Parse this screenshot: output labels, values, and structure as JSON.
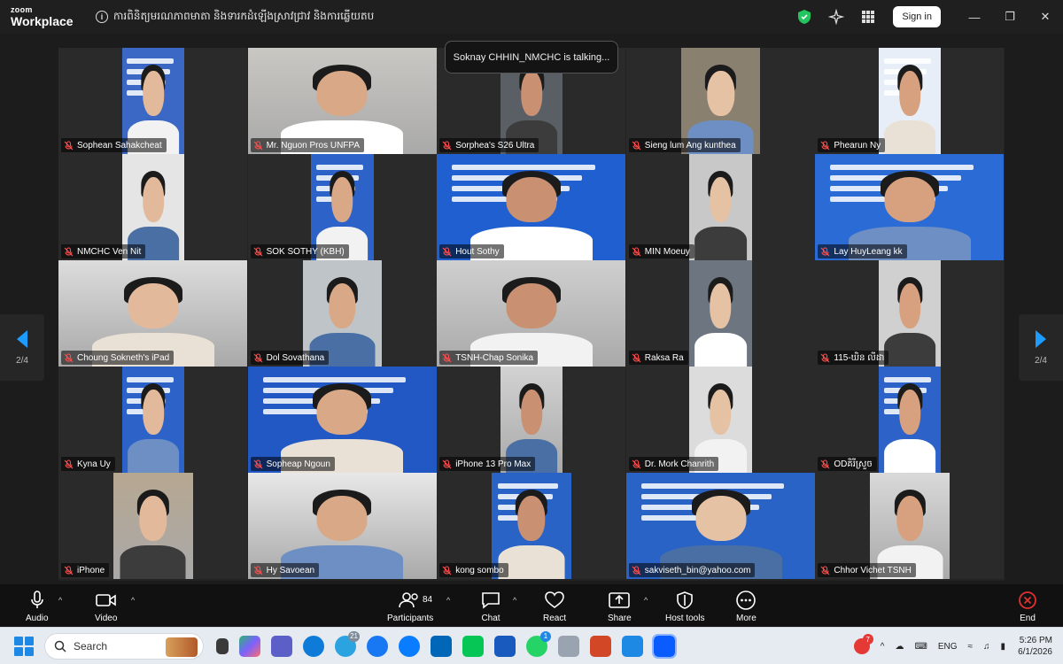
{
  "app": {
    "brand_top": "zoom",
    "brand_bottom": "Workplace",
    "meeting_title": "ការពិនិត្យមរណភាពមាតា និងទារកដំឡើងស្រាវជ្រាវ និងការឆ្លើយតប",
    "sign_in": "Sign in"
  },
  "stage": {
    "talking": "Soknay CHHIN_NMCHC is talking...",
    "page_left": "2/4",
    "page_right": "2/4"
  },
  "participants": [
    {
      "name": "Sophean Sahakcheat"
    },
    {
      "name": "Mr. Nguon Pros UNFPA"
    },
    {
      "name": "Sorphea's S26 Ultra"
    },
    {
      "name": "Sieng lum Ang kunthea"
    },
    {
      "name": "Phearun Ny"
    },
    {
      "name": "NMCHC Ven Nit"
    },
    {
      "name": "SOK SOTHY (KBH)"
    },
    {
      "name": "Hout Sothy"
    },
    {
      "name": "MIN Moeuy"
    },
    {
      "name": "Lay HuyLeang kk"
    },
    {
      "name": "Choung Sokneth's iPad"
    },
    {
      "name": "Dol Sovathana"
    },
    {
      "name": "TSNH-Chap Sonika"
    },
    {
      "name": "Raksa Ra"
    },
    {
      "name": "115-ឃិន លីដា"
    },
    {
      "name": "Kyna Uy"
    },
    {
      "name": "Sopheap Ngoun"
    },
    {
      "name": "iPhone 13 Pro Max"
    },
    {
      "name": "Dr. Mork Chanrith"
    },
    {
      "name": "ODគិរីស្រួច"
    },
    {
      "name": "iPhone"
    },
    {
      "name": "Hy Savoean"
    },
    {
      "name": "kong sombo"
    },
    {
      "name": "sakviseth_bin@yahoo.com"
    },
    {
      "name": "Chhor Vichet TSNH"
    }
  ],
  "toolbar": {
    "audio": "Audio",
    "video": "Video",
    "participants": "Participants",
    "participants_count": "84",
    "chat": "Chat",
    "react": "React",
    "share": "Share",
    "host_tools": "Host tools",
    "more": "More",
    "end": "End"
  },
  "taskbar": {
    "search": "Search",
    "lang": "ENG",
    "time": "5:26 PM",
    "date": "6/1/2026",
    "telegram_badge": "21",
    "whatsapp_badge": "1",
    "app_badge": "7"
  }
}
